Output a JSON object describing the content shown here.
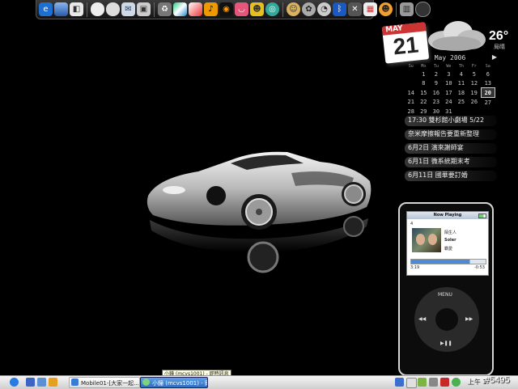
{
  "calendar": {
    "month_title": "May 2006",
    "next_arrow": "▶",
    "weekday_headers": [
      "Su",
      "Mo",
      "Tu",
      "We",
      "Th",
      "Fr",
      "Sa"
    ],
    "weeks": [
      [
        "",
        "1",
        "2",
        "3",
        "4",
        "5",
        "6"
      ],
      [
        "",
        "8",
        "9",
        "10",
        "11",
        "12",
        "13"
      ],
      [
        "14",
        "15",
        "16",
        "17",
        "18",
        "19",
        "20"
      ],
      [
        "21",
        "22",
        "23",
        "24",
        "25",
        "26",
        "27"
      ],
      [
        "28",
        "29",
        "30",
        "31",
        "",
        "",
        ""
      ]
    ],
    "today": "20"
  },
  "date_widget": {
    "month": "MAY",
    "day": "21"
  },
  "weather": {
    "temperature": "26°",
    "condition_label": "局晴",
    "icon": "cloud-icon"
  },
  "events": [
    "17:30 雙杉館小劇場  5/22",
    "奈米摩擦報告要重新整理",
    "6月2日 演來謝師宴",
    "6月1日 微系統期末考",
    "6月11日 國華要訂婚"
  ],
  "ipod": {
    "header": "Now Playing",
    "track_number": "4",
    "album_label": "陌生人",
    "artist": "Soler",
    "title": "霸愛",
    "elapsed": "3:19",
    "remaining": "-0:53",
    "progress": 0.79,
    "menu_label": "MENU",
    "prev_label": "◀◀",
    "next_label": "▶▶",
    "play_label": "▶❚❚"
  },
  "taskbar": {
    "tasks": [
      {
        "label": "Mobile01-[大家一起...",
        "active": false
      },
      {
        "label": "小鐘 (mcvs1001) - 即...",
        "active": true
      }
    ],
    "tooltip": "小鐘 (mcvs1001) - 即時訊息",
    "clock": "上午 1:",
    "tray_icons": [
      "network-icon",
      "ime-icon",
      "antivirus-icon",
      "volume-icon",
      "kaspersky-icon",
      "msn-icon"
    ]
  },
  "watermark": "#5495",
  "dock_icons": [
    "ie-icon",
    "desktop-icon",
    "finder-icon",
    "cloud-icon",
    "cloud-icon",
    "mail-icon",
    "photo-icon",
    "recycle-icon",
    "color-icon",
    "chart-icon",
    "music-icon",
    "lips-icon",
    "video-icon",
    "smile-icon",
    "globe-icon",
    "messenger-icon",
    "bluetooth-icon",
    "tools-icon",
    "calendar-icon",
    "poison-icon",
    "trash-icon",
    "record-icon"
  ],
  "colors": {
    "accent_blue": "#2f6cc0",
    "calendar_red": "#cc3333"
  }
}
